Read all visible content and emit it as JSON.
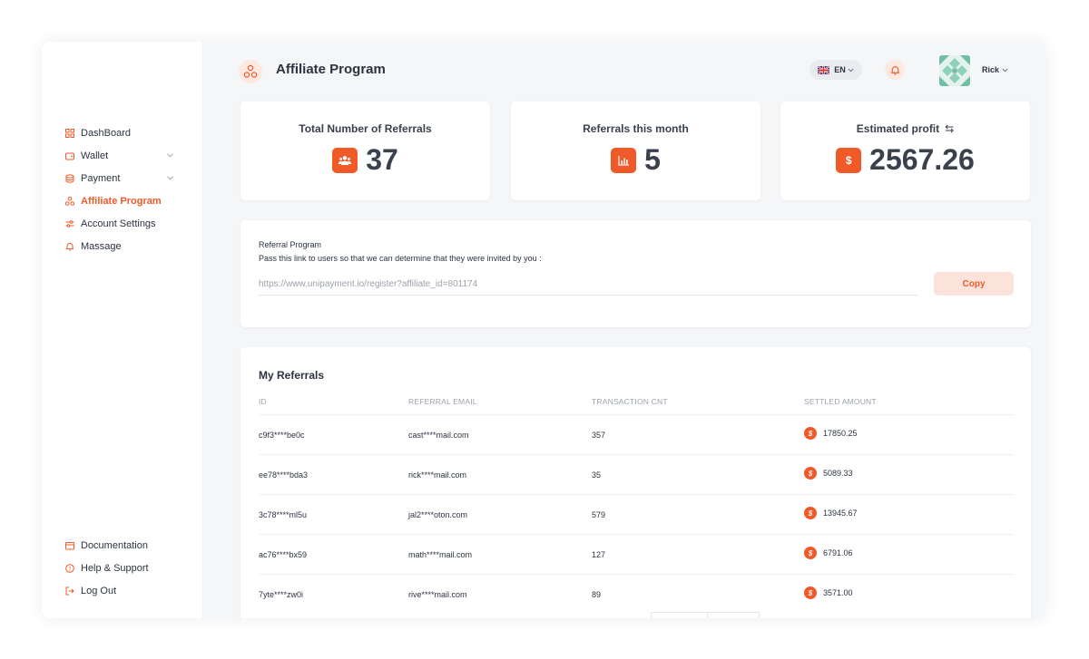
{
  "sidebar": {
    "items": [
      {
        "label": "DashBoard",
        "icon": "grid-icon"
      },
      {
        "label": "Wallet",
        "icon": "wallet-icon"
      },
      {
        "label": "Payment",
        "icon": "payment-icon"
      },
      {
        "label": "Affiliate Program",
        "icon": "affiliate-icon"
      },
      {
        "label": "Account Settings",
        "icon": "settings-icon"
      },
      {
        "label": "Massage",
        "icon": "bell-icon"
      }
    ],
    "bottom_items": [
      {
        "label": "Documentation",
        "icon": "document-icon"
      },
      {
        "label": "Help & Support",
        "icon": "help-icon"
      },
      {
        "label": "Log Out",
        "icon": "logout-icon"
      }
    ],
    "active": "Affiliate Program"
  },
  "header": {
    "title": "Affiliate Program",
    "language": "EN",
    "user_name": "Rick"
  },
  "stats": [
    {
      "title": "Total Number of Referrals",
      "value": "37",
      "icon": "users-icon"
    },
    {
      "title": "Referrals this month",
      "value": "5",
      "icon": "bar-chart-icon"
    },
    {
      "title": "Estimated profit",
      "value": "2567.26",
      "icon": "dollar-icon"
    }
  ],
  "referral": {
    "title": "Referral Program",
    "description": "Pass this link to users so that we can determine that they were invited by you :",
    "link": "https://www.unipayment.io/register?affiliate_id=801174",
    "copy_label": "Copy"
  },
  "referrals": {
    "title": "My Referrals",
    "columns": [
      "ID",
      "REFERRAL EMAIL",
      "TRANSACTION CNT",
      "SETTLED AMOUNT"
    ],
    "rows": [
      {
        "id": "c9f3****be0c",
        "email": "cast****mail.com",
        "count": "357",
        "amount": "17850.25"
      },
      {
        "id": "ee78****bda3",
        "email": "rick****mail.com",
        "count": "35",
        "amount": "5089.33"
      },
      {
        "id": "3c78****ml5u",
        "email": "jal2****oton.com",
        "count": "579",
        "amount": "13945.67"
      },
      {
        "id": "ac76****bx59",
        "email": "math****mail.com",
        "count": "127",
        "amount": "6791.06"
      },
      {
        "id": "7yte****zw0i",
        "email": "rive****mail.com",
        "count": "89",
        "amount": "3571.00"
      }
    ]
  },
  "colors": {
    "accent": "#f05a28",
    "accent_light": "#fbe3dc",
    "background": "#f5f6f8",
    "text": "#2c3340"
  }
}
